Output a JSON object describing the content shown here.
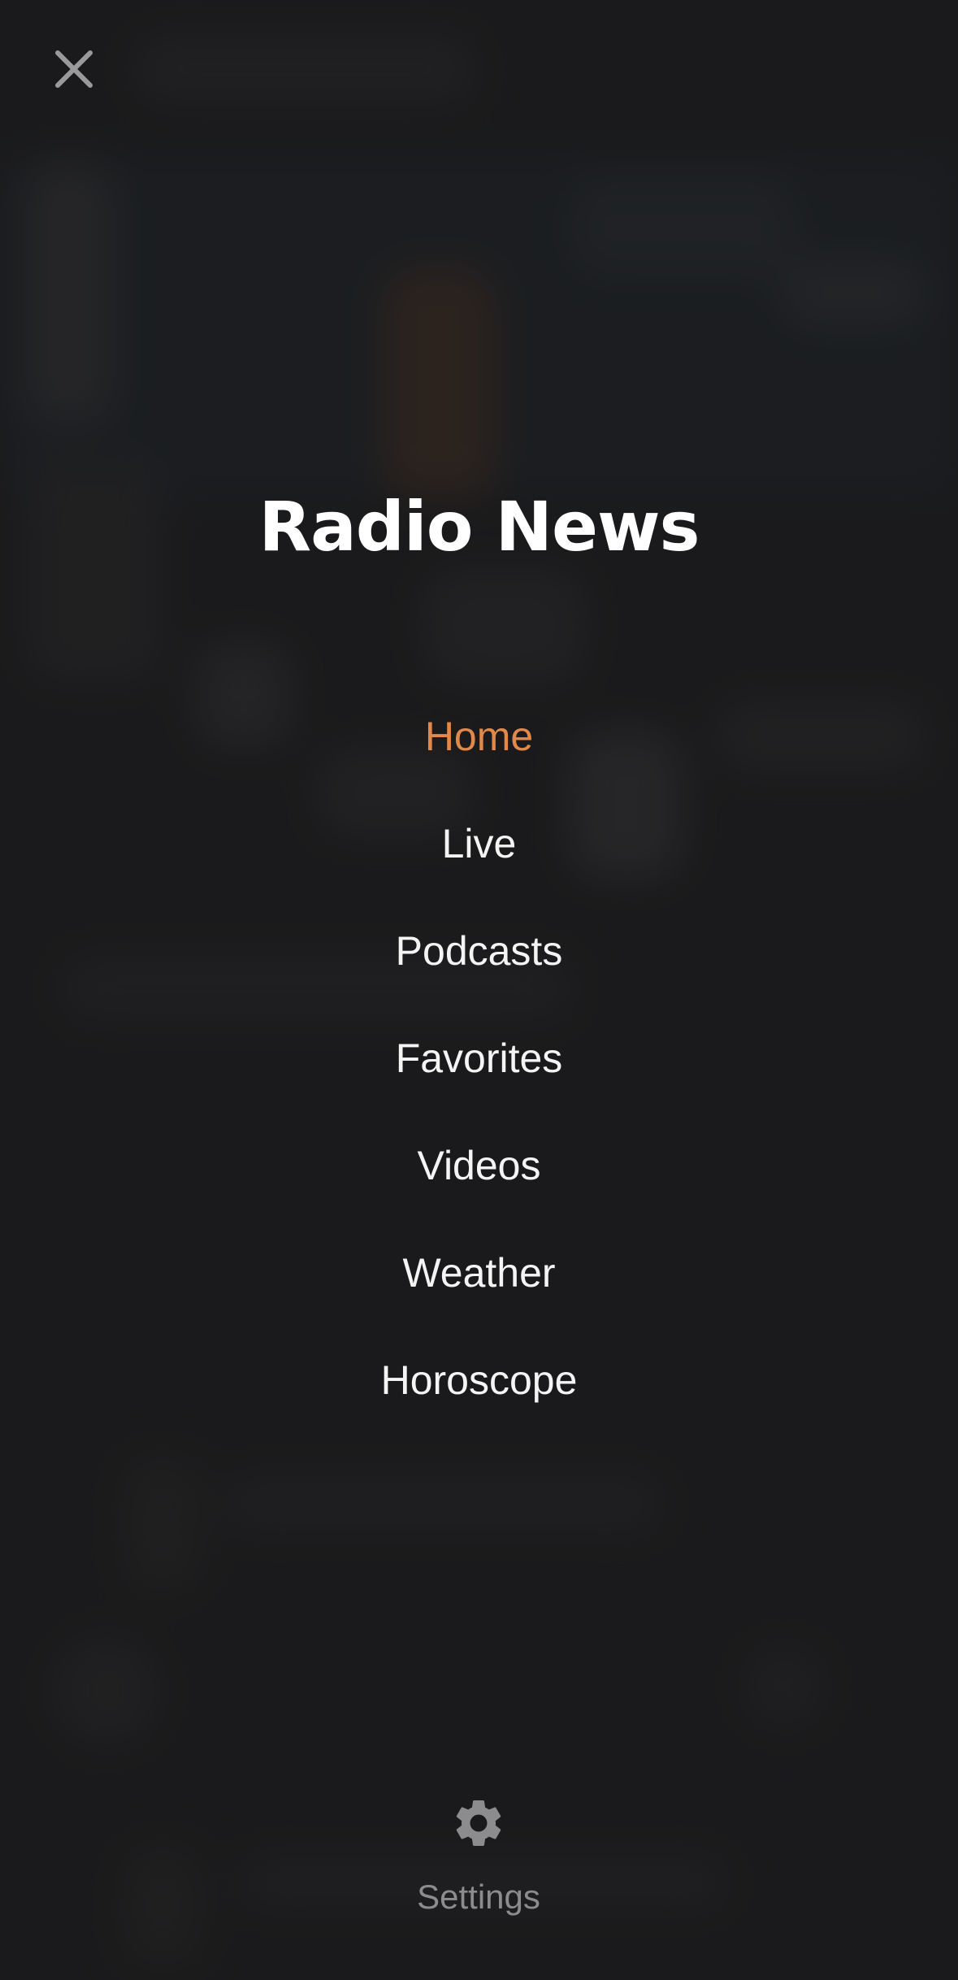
{
  "app": {
    "title": "Radio News"
  },
  "menu": {
    "close_icon": "close-icon",
    "items": [
      {
        "label": "Home",
        "active": true
      },
      {
        "label": "Live",
        "active": false
      },
      {
        "label": "Podcasts",
        "active": false
      },
      {
        "label": "Favorites",
        "active": false
      },
      {
        "label": "Videos",
        "active": false
      },
      {
        "label": "Weather",
        "active": false
      },
      {
        "label": "Horoscope",
        "active": false
      }
    ],
    "settings": {
      "label": "Settings",
      "icon": "gear-icon"
    }
  },
  "colors": {
    "background": "#1e1e1f",
    "accent": "#e0894a",
    "text": "#f4f4f4",
    "muted": "#8c8c8e"
  }
}
